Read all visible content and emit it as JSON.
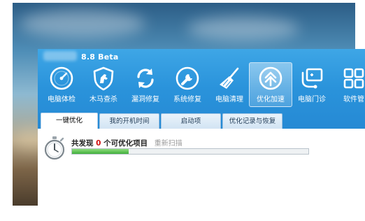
{
  "window": {
    "title": "8.8 Beta"
  },
  "toolbar": [
    {
      "label": "电脑体检",
      "icon": "speedometer-icon"
    },
    {
      "label": "木马查杀",
      "icon": "shield-horse-icon"
    },
    {
      "label": "漏洞修复",
      "icon": "refresh-arrows-icon"
    },
    {
      "label": "系统修复",
      "icon": "wrench-icon"
    },
    {
      "label": "电脑清理",
      "icon": "broom-icon"
    },
    {
      "label": "优化加速",
      "icon": "speedup-arrows-icon",
      "active": true
    },
    {
      "label": "电脑门诊",
      "icon": "clinic-monitor-icon"
    },
    {
      "label": "软件管",
      "icon": "grid-icon"
    }
  ],
  "tabs": [
    {
      "label": "一键优化",
      "active": true
    },
    {
      "label": "我的开机时间"
    },
    {
      "label": "启动项"
    },
    {
      "label": "优化记录与恢复"
    }
  ],
  "status": {
    "prefix": "共发现",
    "count": "0",
    "suffix": "个可优化项目",
    "rescan": "重新扫描",
    "progress": 0.24
  },
  "colors": {
    "accent": "#2a93db",
    "count": "#d01010",
    "progress": "#3fae3b"
  }
}
